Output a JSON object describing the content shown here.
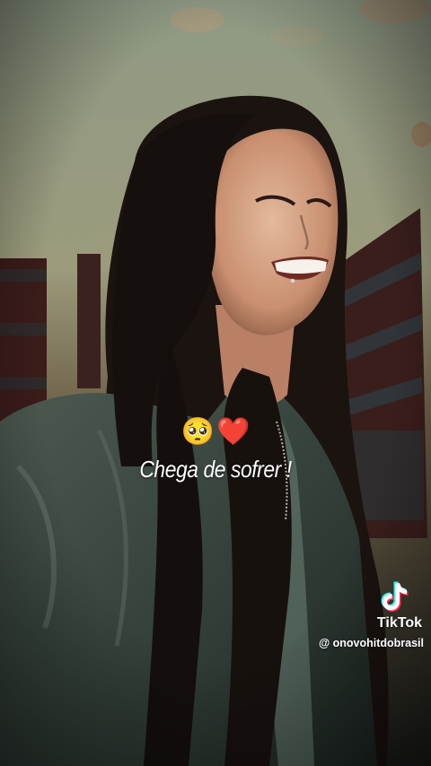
{
  "caption": {
    "emoji_1": "🥺",
    "emoji_2": "❤️",
    "text": "Chega de sofrer !"
  },
  "watermark": {
    "brand": "TikTok",
    "handle": "@ onovohitdobrasil",
    "icon": "tiktok-logo-icon"
  }
}
